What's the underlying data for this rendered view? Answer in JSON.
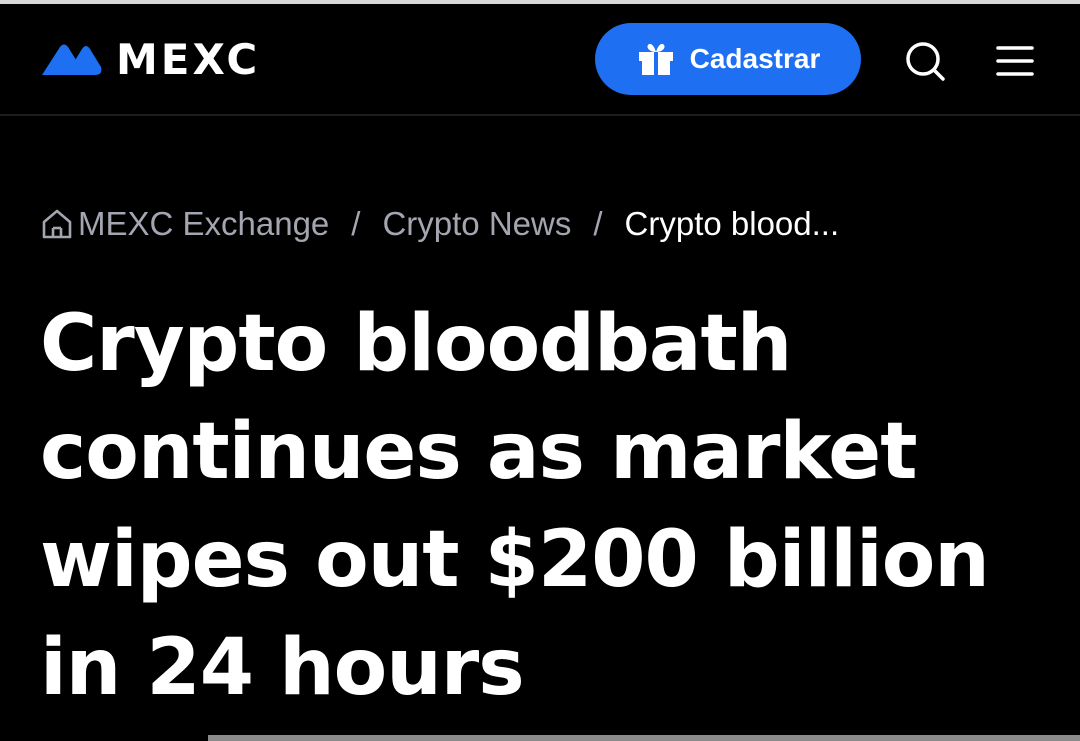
{
  "header": {
    "logo_text": "MEXC",
    "signup_label": "Cadastrar"
  },
  "icons": {
    "logo": "mexc-logo-mark",
    "gift": "gift-icon",
    "search": "search-icon",
    "menu": "hamburger-menu-icon",
    "home": "home-icon"
  },
  "breadcrumb": {
    "items": [
      {
        "label": "MEXC Exchange"
      },
      {
        "label": "Crypto News"
      }
    ],
    "separator": "/",
    "current": "Crypto blood..."
  },
  "article": {
    "title": "Crypto bloodbath continues as market wipes out $200 billion in 24 hours"
  },
  "colors": {
    "background": "#000000",
    "accent": "#1e6ff1",
    "text_primary": "#ffffff",
    "text_muted": "#a3a6b0"
  }
}
